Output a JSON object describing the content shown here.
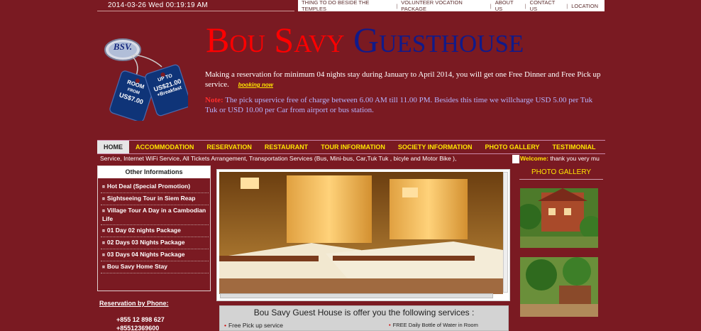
{
  "topbar": {
    "datetime": "2014-03-26  Wed  00:19:19  AM",
    "links": [
      "THING TO DO BESIDE THE TEMPLES",
      "VOLUNTEER VOCATION PACKAGE",
      "ABOUT US",
      "CONTACT US",
      "LOCATION"
    ]
  },
  "logo": {
    "initials": "BSV.",
    "tag_left": [
      "ROOM",
      "FROM",
      "US$7.00"
    ],
    "tag_right": [
      "UP TO",
      "US$21.00",
      "+Breakfast"
    ]
  },
  "site_title": {
    "part1": "Bou Savy",
    "part2": "Guesthouse"
  },
  "promo": {
    "text": "Making a reservation for minimum 04 nights stay during January to April  2014, you will get one Free Dinner and Free Pick up service.",
    "link": "booking now"
  },
  "note": {
    "label": "Note:",
    "text": " The pick upservice free of charge between 6.00 AM till 11.00 PM. Besides this time we willcharge USD 5.00 per Tuk Tuk or USD 10.00 per Car from airport or bus station."
  },
  "nav": [
    "HOME",
    "ACCOMMODATION",
    "RESERVATION",
    "RESTAURANT",
    "TOUR INFORMATION",
    "SOCIETY INFORMATION",
    "PHOTO GALLERY",
    "TESTIMONIAL"
  ],
  "marquee": {
    "text": "Service, Internet WiFi Service, All Tickets Arrangement, Transportation Services (Bus, Mini-bus, Car,Tuk Tuk , bicyle and Motor Bike ),",
    "welcome_label": "Welcome:",
    "welcome_text": " thank you very mu"
  },
  "sidebar": {
    "title": "Other Informations",
    "items": [
      "Hot Deal (Special Promotion)",
      "Sightseeing Tour in Siem Reap",
      "Village Tour A Day in a Cambodian Life",
      "01 Day 02 nights Package",
      "02 Days 03 Nights Package",
      "03 Days 04 Nights Package",
      "Bou Savy Home Stay"
    ]
  },
  "phone": {
    "title": "Reservation by Phone:",
    "numbers": [
      "+855 12 898 627",
      "+85512369600"
    ]
  },
  "services": {
    "title": "Bou Savy Guest House is offer you the following services :",
    "items": [
      "Free Pick up service",
      "FREE Daily Bottle of Water in Room"
    ]
  },
  "gallery": {
    "title": "PHOTO GALLERY"
  },
  "colors": {
    "background": "#7a1a22",
    "accent_yellow": "#ffe600",
    "title_red": "#ff0000",
    "title_blue": "#101a8a"
  }
}
